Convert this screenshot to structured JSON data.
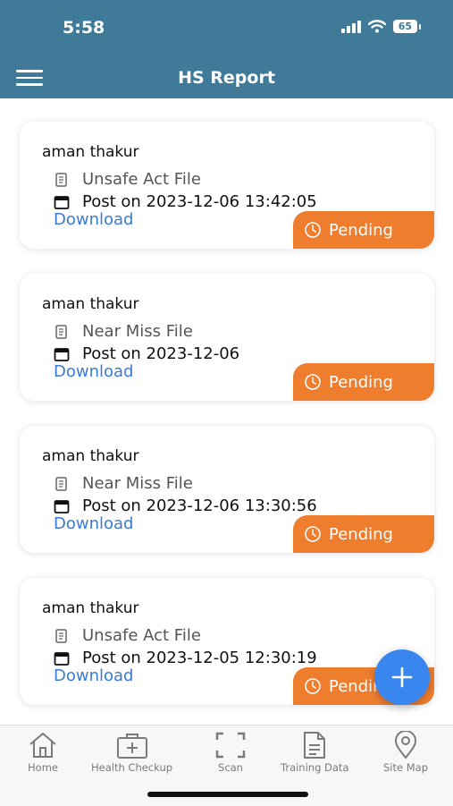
{
  "status_bar": {
    "time": "5:58",
    "battery": "65"
  },
  "header": {
    "title": "HS Report"
  },
  "cards": [
    {
      "name": "aman thakur",
      "file": "Unsafe Act File",
      "posted": "Post on 2023-12-06 13:42:05",
      "download": "Download",
      "status": "Pending"
    },
    {
      "name": "aman thakur",
      "file": "Near Miss File",
      "posted": "Post on 2023-12-06",
      "download": "Download",
      "status": "Pending"
    },
    {
      "name": "aman thakur",
      "file": "Near Miss File",
      "posted": "Post on 2023-12-06 13:30:56",
      "download": "Download",
      "status": "Pending"
    },
    {
      "name": "aman thakur",
      "file": "Unsafe Act File",
      "posted": "Post on 2023-12-05 12:30:19",
      "download": "Download",
      "status": "Pending"
    }
  ],
  "bottom_nav": [
    {
      "label": "Home",
      "icon": "home-icon"
    },
    {
      "label": "Health Checkup",
      "icon": "medical-kit-icon"
    },
    {
      "label": "Scan",
      "icon": "scan-icon"
    },
    {
      "label": "Training Data",
      "icon": "document-icon"
    },
    {
      "label": "Site Map",
      "icon": "location-pin-icon"
    }
  ],
  "colors": {
    "header": "#3f7a98",
    "pending": "#ef7d2e",
    "link": "#3a7bd5",
    "fab": "#3a86ef"
  }
}
